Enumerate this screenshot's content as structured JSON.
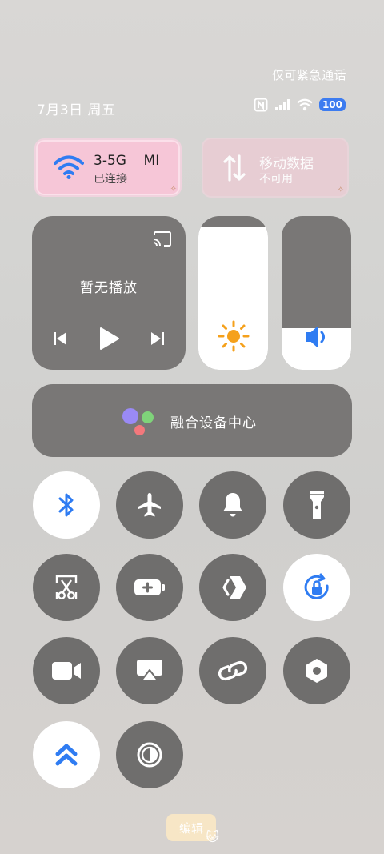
{
  "status_bar": {
    "emergency_text": "仅可紧急通话",
    "date_text": "7月3日 周五",
    "battery_level": "100"
  },
  "wifi": {
    "name": "3-5G    MI",
    "status": "已连接"
  },
  "mobile_data": {
    "name": "移动数据",
    "status": "不可用"
  },
  "media": {
    "title": "暂无播放"
  },
  "brightness": {
    "level": 0.93
  },
  "volume": {
    "level": 0.27
  },
  "fusion": {
    "label": "融合设备中心"
  },
  "edit": {
    "label": "编辑"
  },
  "colors": {
    "accent": "#3d7cf0",
    "tile_dark": "#797776",
    "toggle_off": "#6f6e6d",
    "toggle_on": "#ffffff",
    "wifi_tile": "#f6c6d7"
  }
}
